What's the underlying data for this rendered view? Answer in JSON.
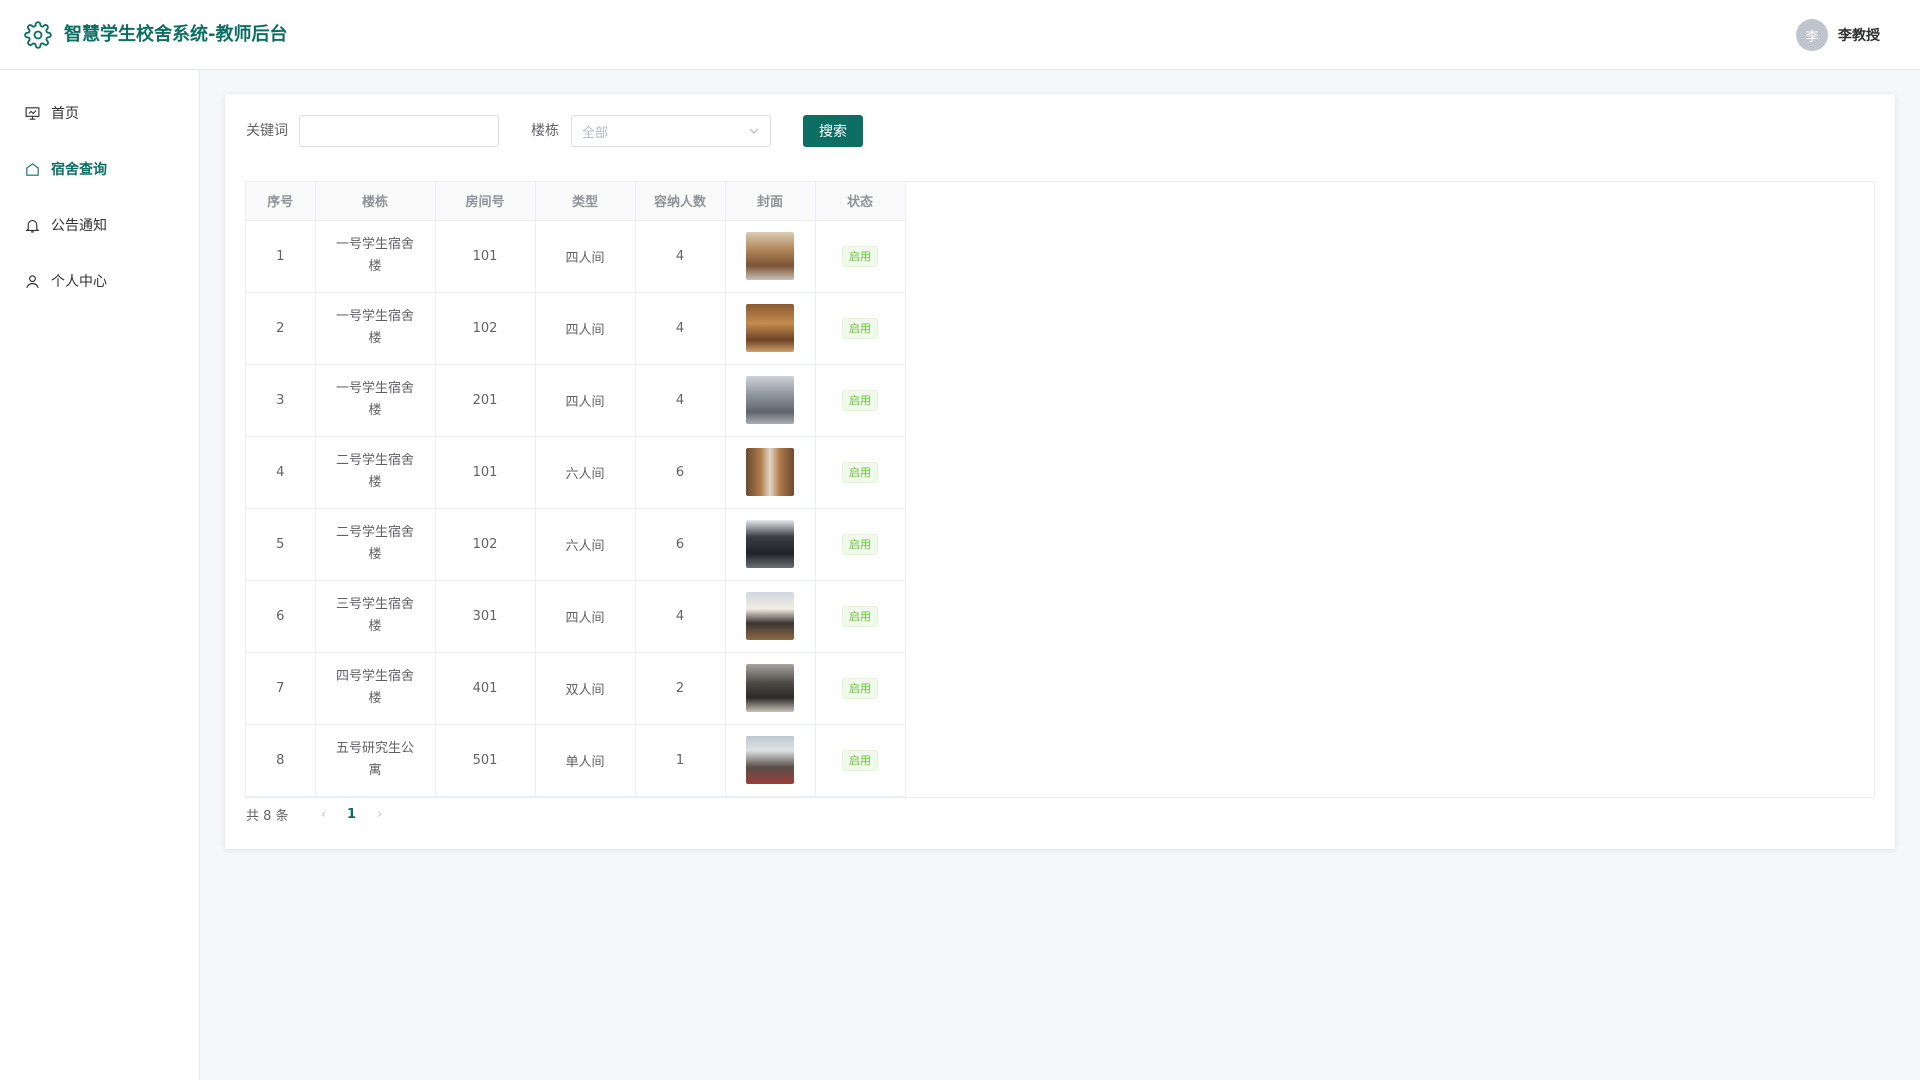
{
  "app": {
    "title": "智慧学生校舍系统-教师后台",
    "logo_icon": "gear-icon",
    "accent_color": "#0d6e64"
  },
  "user": {
    "avatar_text": "李",
    "name": "李教授"
  },
  "sidebar": {
    "items": [
      {
        "label": "首页",
        "icon": "presentation-icon",
        "active": false
      },
      {
        "label": "宿舍查询",
        "icon": "home-icon",
        "active": true
      },
      {
        "label": "公告通知",
        "icon": "bell-icon",
        "active": false
      },
      {
        "label": "个人中心",
        "icon": "user-icon",
        "active": false
      }
    ]
  },
  "search": {
    "keyword_label": "关键词",
    "keyword_value": "",
    "building_label": "楼栋",
    "building_value": "全部",
    "button_label": "搜索"
  },
  "table": {
    "headers": [
      "序号",
      "楼栋",
      "房间号",
      "类型",
      "容纳人数",
      "封面",
      "状态"
    ],
    "rows": [
      {
        "index": "1",
        "building": "一号学生宿舍楼",
        "room": "101",
        "type": "四人间",
        "capacity": "4",
        "cover": "dorm-corridor",
        "status": "启用"
      },
      {
        "index": "2",
        "building": "一号学生宿舍楼",
        "room": "102",
        "type": "四人间",
        "capacity": "4",
        "cover": "dorm-wood",
        "status": "启用"
      },
      {
        "index": "3",
        "building": "一号学生宿舍楼",
        "room": "201",
        "type": "四人间",
        "capacity": "4",
        "cover": "dorm-grey",
        "status": "启用"
      },
      {
        "index": "4",
        "building": "二号学生宿舍楼",
        "room": "101",
        "type": "六人间",
        "capacity": "6",
        "cover": "dorm-lockers",
        "status": "启用"
      },
      {
        "index": "5",
        "building": "二号学生宿舍楼",
        "room": "102",
        "type": "六人间",
        "capacity": "6",
        "cover": "dorm-dark",
        "status": "启用"
      },
      {
        "index": "6",
        "building": "三号学生宿舍楼",
        "room": "301",
        "type": "四人间",
        "capacity": "4",
        "cover": "dorm-window",
        "status": "启用"
      },
      {
        "index": "7",
        "building": "四号学生宿舍楼",
        "room": "401",
        "type": "双人间",
        "capacity": "2",
        "cover": "dorm-double",
        "status": "启用"
      },
      {
        "index": "8",
        "building": "五号研究生公寓",
        "room": "501",
        "type": "单人间",
        "capacity": "1",
        "cover": "dorm-single",
        "status": "启用"
      }
    ]
  },
  "pagination": {
    "total_text": "共 8 条",
    "current_page": "1",
    "prev_icon": "chevron-left-icon",
    "next_icon": "chevron-right-icon"
  }
}
